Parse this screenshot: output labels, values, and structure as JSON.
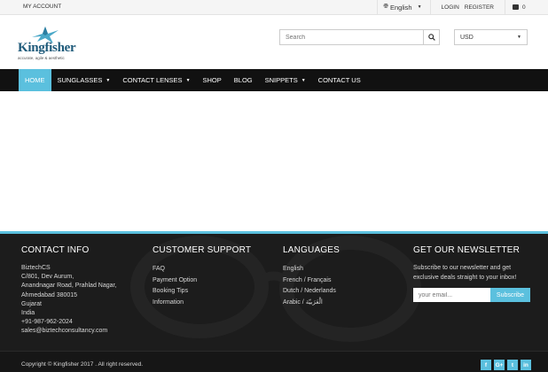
{
  "topbar": {
    "my_account": "MY ACCOUNT",
    "language": "English",
    "login": "LOGIN",
    "register": "REGISTER",
    "cart_count": "0"
  },
  "header": {
    "logo_name": "Kingfisher",
    "logo_tagline": "accurate, agile & aesthetic",
    "search_placeholder": "Search",
    "currency": "USD"
  },
  "nav": {
    "items": [
      {
        "label": "HOME"
      },
      {
        "label": "SUNGLASSES"
      },
      {
        "label": "CONTACT LENSES"
      },
      {
        "label": "SHOP"
      },
      {
        "label": "BLOG"
      },
      {
        "label": "SNIPPETS"
      },
      {
        "label": "CONTACT US"
      }
    ]
  },
  "footer": {
    "contact": {
      "title": "CONTACT INFO",
      "lines": [
        "BiztechCS",
        "C/801, Dev Aurum,",
        "Anandnagar Road, Prahlad Nagar,",
        "Ahmedabad 380015",
        "Gujarat",
        "India",
        "+91-987-962-2024",
        "sales@biztechconsultancy.com"
      ]
    },
    "support": {
      "title": "CUSTOMER SUPPORT",
      "links": [
        "FAQ",
        "Payment Option",
        "Booking Tips",
        "Information"
      ]
    },
    "languages": {
      "title": "LANGUAGES",
      "links": [
        "English",
        "French / Français",
        "Dutch / Nederlands",
        "Arabic / الْعَرَبيّة"
      ]
    },
    "newsletter": {
      "title": "GET OUR NEWSLETTER",
      "text": "Subscribe to our newsletter and get exclusive deals straight to your inbox!",
      "placeholder": "your email...",
      "button": "Subscribe"
    },
    "copyright": "Copyright © Kingfisher 2017 . All right reserved.",
    "social": [
      "f",
      "G+",
      "t",
      "in"
    ]
  },
  "colors": {
    "accent": "#5bc0de",
    "nav_bg": "#111111",
    "footer_bg": "#1c1c1c",
    "logo": "#1e5a7a"
  }
}
